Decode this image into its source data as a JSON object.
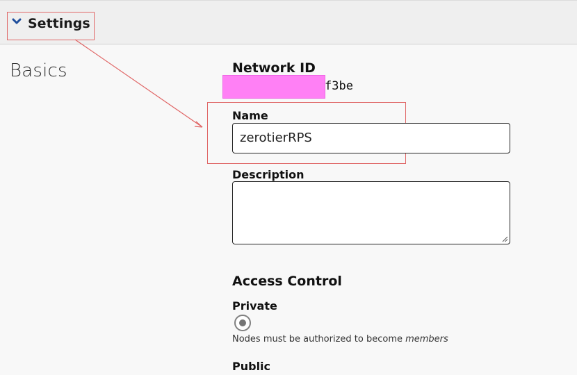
{
  "header": {
    "title": "Settings",
    "toggle_icon": "chevron-down-icon"
  },
  "section": {
    "title": "Basics"
  },
  "network_id": {
    "label": "Network ID",
    "value_suffix": "f3be"
  },
  "name": {
    "label": "Name",
    "value": "zerotierRPS"
  },
  "description": {
    "label": "Description",
    "value": ""
  },
  "access_control": {
    "title": "Access Control",
    "private": {
      "label": "Private",
      "selected": true,
      "hint_prefix": "Nodes must be authorized to become ",
      "hint_emphasis": "members"
    },
    "public": {
      "label": "Public"
    }
  },
  "colors": {
    "annotation": "#e06666",
    "redaction": "#ff80f5"
  }
}
